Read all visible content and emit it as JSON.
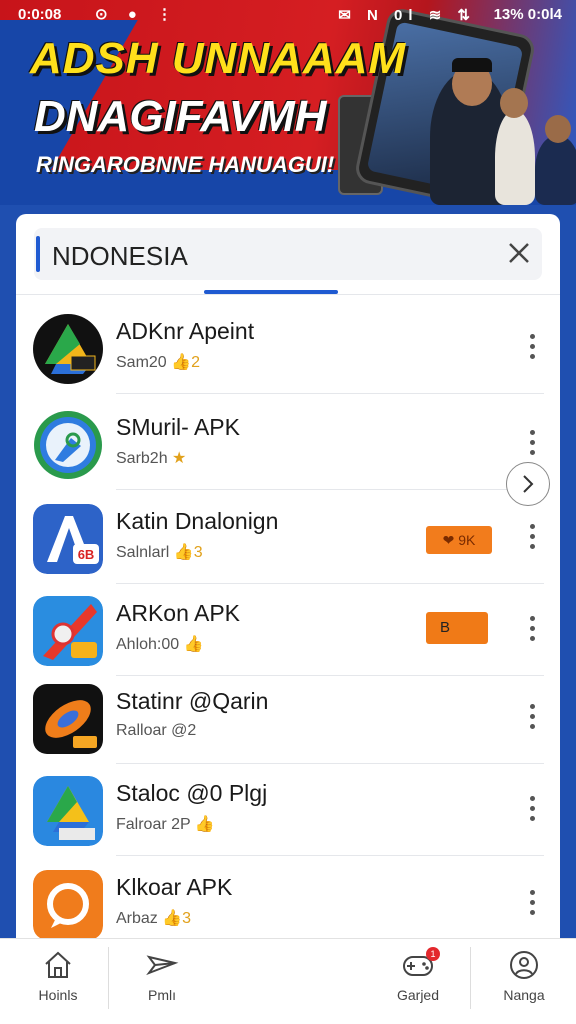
{
  "status_bar": {
    "time": "0:0:08",
    "left_icons": "⊙ ●  ⋮",
    "right_icons": "✉ N 0l ≋ ⇅",
    "battery": "13%",
    "clock_right": "0:0l4"
  },
  "banner": {
    "headline": "ADSH UNNAAAM",
    "headline2": "DNAGIFAVMH",
    "tagline": "RINGAROBNNE HANUAGUI!"
  },
  "search": {
    "value": "NDONESIA"
  },
  "apps": [
    {
      "title": "ADKnr Apeint",
      "sub": "Sam20",
      "sub_star": "👍2",
      "icon": "green-drive-icon"
    },
    {
      "title": "SMuril- APK",
      "sub": "Sarb2h",
      "sub_star": "★",
      "icon": "blue-circle-app-icon"
    },
    {
      "title": "Katin Dnalonign",
      "sub": "Salnlarl",
      "sub_star": "👍3",
      "badge": "9K",
      "icon": "blue-a-app-icon"
    },
    {
      "title": "ARKon APK",
      "sub": "Ahloh:00",
      "sub_star": "👍",
      "badge": "B",
      "icon": "rocket-app-icon"
    },
    {
      "title": "Statinr @Qarin",
      "sub": "Ralloar @2",
      "sub_star": "",
      "icon": "dark-orange-app-icon"
    },
    {
      "title": "Staloc @0 Plgj",
      "sub": "Falroar 2P",
      "sub_star": "👍",
      "icon": "drive-triangle-icon"
    },
    {
      "title": "Klkoar APK",
      "sub": "Arbaz",
      "sub_star": "👍3",
      "icon": "orange-chat-icon"
    }
  ],
  "bottom_nav": [
    {
      "label": "Hoinls",
      "icon": "home-icon"
    },
    {
      "label": "Pmlı",
      "icon": "send-icon"
    },
    {
      "label": "Garjed",
      "icon": "gamepad-icon",
      "badge": "1"
    },
    {
      "label": "Nanga",
      "icon": "profile-icon"
    }
  ],
  "colors": {
    "brand_blue": "#1f4fb0",
    "accent_blue": "#1f5ad1",
    "banner_red": "#d51e22",
    "headline_yellow": "#ffe01b",
    "badge_orange": "#f27c1c"
  }
}
